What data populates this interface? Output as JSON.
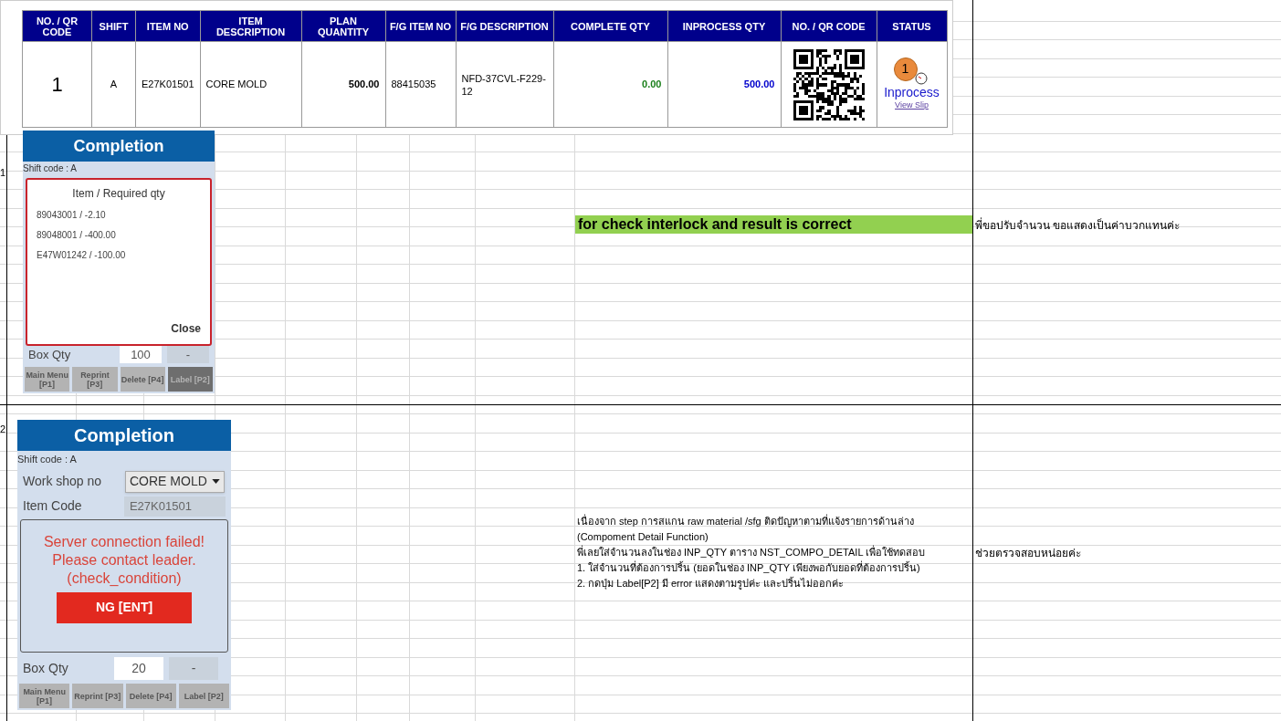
{
  "row_markers": [
    "1",
    "2"
  ],
  "order_table": {
    "columns": [
      "NO. / QR CODE",
      "SHIFT",
      "ITEM NO",
      "ITEM DESCRIPTION",
      "PLAN QUANTITY",
      "F/G ITEM NO",
      "F/G DESCRIPTION",
      "COMPLETE QTY",
      "INPROCESS QTY",
      "NO. / QR CODE",
      "STATUS"
    ],
    "rows": [
      {
        "no": "1",
        "shift": "A",
        "item_no": "E27K01501",
        "item_description": "CORE MOLD",
        "plan_quantity": "500.00",
        "fg_item_no": "88415035",
        "fg_description": "NFD-37CVL-F229-12",
        "complete_qty": "0.00",
        "inprocess_qty": "500.00",
        "status": {
          "badge": "1",
          "label": "Inprocess",
          "link": "View Slip"
        }
      }
    ]
  },
  "screen_1": {
    "title": "Completion",
    "shift_code": "Shift code : A",
    "dialog": {
      "title": "Item / Required qty",
      "items": [
        "89043001 / -2.10",
        "89048001 / -400.00",
        "E47W01242 / -100.00"
      ],
      "close": "Close"
    },
    "box_qty": {
      "label": "Box Qty",
      "ok": "100",
      "ng": "-"
    },
    "buttons": [
      {
        "label": "Main Menu [P1]",
        "disabled": false
      },
      {
        "label": "Reprint [P3]",
        "disabled": false
      },
      {
        "label": "Delete [P4]",
        "disabled": false
      },
      {
        "label": "Label [P2]",
        "disabled": true
      }
    ]
  },
  "screen_2": {
    "title": "Completion",
    "shift_code": "Shift code : A",
    "workshop": {
      "label": "Work shop no",
      "value": "CORE MOLD"
    },
    "item_code": {
      "label": "Item Code",
      "value": "E27K01501"
    },
    "error_dialog": {
      "message": [
        "Server connection failed!",
        "Please contact leader.",
        "(check_condition)"
      ],
      "button": "NG [ENT]"
    },
    "box_qty": {
      "label": "Box Qty",
      "ok": "20",
      "ng": "-"
    },
    "buttons": [
      {
        "label": "Main Menu [P1]",
        "disabled": false
      },
      {
        "label": "Reprint [P3]",
        "disabled": false
      },
      {
        "label": "Delete [P4]",
        "disabled": false
      },
      {
        "label": "Label [P2]",
        "disabled": false
      }
    ]
  },
  "notes": {
    "highlight": "for check interlock and result is correct",
    "comment_1": "พี่ขอปรับจำนวน ขอแสดงเป็นค่าบวกแทนค่ะ",
    "lines": [
      "เนื่องจาก step การสแกน raw material /sfg ติดปัญหาตามที่แจ้งรายการด้านล่าง",
      "(Compoment Detail Function)",
      "พี่เลยใส่จำนวนลงในช่อง INP_QTY ตาราง NST_COMPO_DETAIL เพื่อใช้ทดสอบ",
      "1. ใส่จำนวนที่ต้องการปริ้น (ยอดในช่อง INP_QTY เพียงพอกับยอดที่ต้องการปริ้น)",
      "2. กดปุ่ม Label[P2] มี error แสดงตามรูปค่ะ และปริ้นไม่ออกค่ะ"
    ],
    "comment_2": "ช่วยตรวจสอบหน่อยค่ะ"
  }
}
